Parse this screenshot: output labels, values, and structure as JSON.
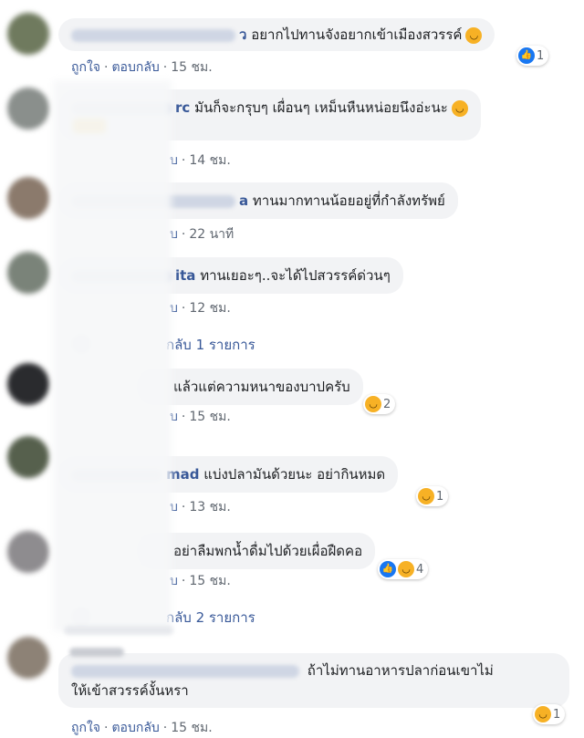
{
  "comments": [
    {
      "name_tail": "ว",
      "text": "อยากไปทานจังอยากเข้าเมืองสวรรค์",
      "actions": {
        "like": "ถูกใจ",
        "reply": "ตอบกลับ",
        "time": "15 ชม."
      },
      "reaction": {
        "icons": [
          "like-icon"
        ],
        "count": "1"
      }
    },
    {
      "name_tail": "rc",
      "text": "มันก็จะกรุบๆ เผื่อนๆ เหม็นหืนหน่อยนึงอ่ะนะ",
      "actions": {
        "reply_suffix": "บ",
        "time": "14 ชม."
      }
    },
    {
      "name_tail": "a",
      "text": "ทานมากทานน้อยอยู่ที่กำลังทรัพย์",
      "actions": {
        "reply_suffix": "บ",
        "time": "22 นาที"
      }
    },
    {
      "name_tail": "ita",
      "text": "ทานเยอะๆ..จะได้ไปสวรรค์ด่วนๆ",
      "actions": {
        "reply_suffix": "บ",
        "time": "12 ชม."
      },
      "replies": "กลับ 1 รายการ"
    },
    {
      "text": "แล้วแต่ความหนาของบาปครับ",
      "actions": {
        "reply_suffix": "บ",
        "time": "15 ชม."
      },
      "reaction": {
        "icons": [
          "haha-icon"
        ],
        "count": "2"
      }
    },
    {
      "name_tail": "mad",
      "text": "แบ่งปลามันด้วยนะ อย่ากินหมด",
      "actions": {
        "reply_suffix": "บ",
        "time": "13 ชม."
      },
      "reaction": {
        "icons": [
          "haha-icon"
        ],
        "count": "1"
      }
    },
    {
      "text": "อย่าลืมพกน้ำดื่มไปด้วยเผื่อฝืดคอ",
      "actions": {
        "reply_suffix": "บ",
        "time": "15 ชม."
      },
      "reaction": {
        "icons": [
          "like-icon",
          "haha-icon"
        ],
        "count": "4"
      },
      "replies": "กลับ 2 รายการ"
    },
    {
      "text_line1": "ถ้าไม่ทานอาหารปลาก่อนเขาไม่",
      "text_line2": "ให้เข้าสวรรค์งั้นหรา",
      "actions": {
        "like": "ถูกใจ",
        "reply": "ตอบกลับ",
        "time": "15 ชม."
      },
      "reaction": {
        "icons": [
          "haha-icon"
        ],
        "count": "1"
      }
    }
  ],
  "colors": {
    "link": "#385898",
    "bubble": "#f2f3f5",
    "meta": "#606770",
    "haha": "#f7b125",
    "like": "#1877f2"
  }
}
